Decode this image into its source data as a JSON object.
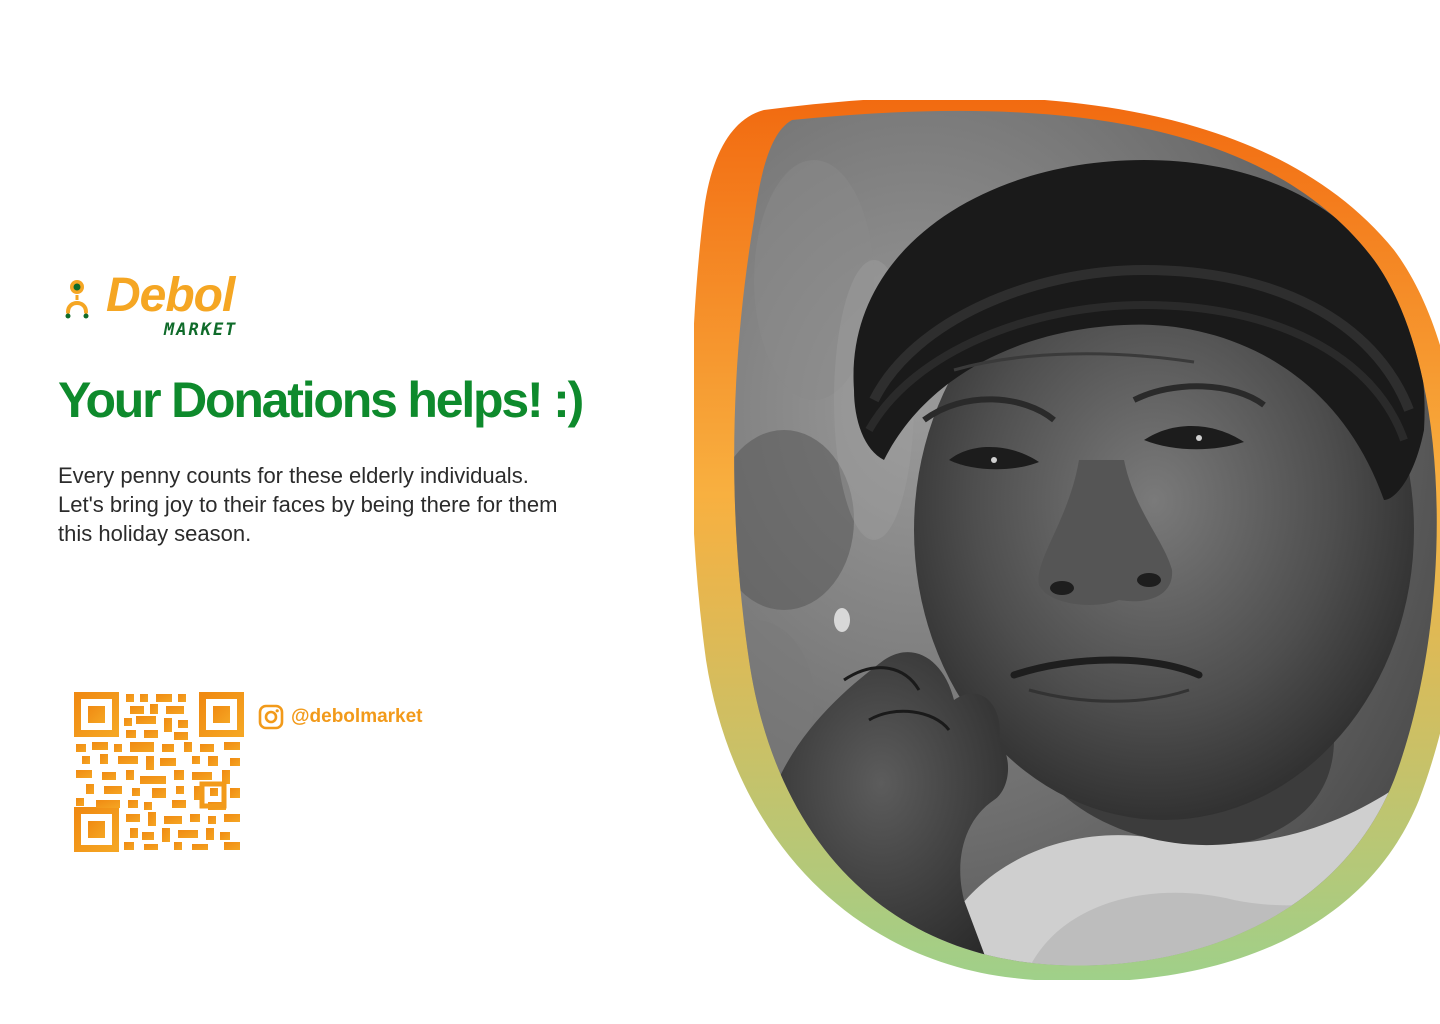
{
  "brand": {
    "name": "Debol",
    "subtitle": "MARKET",
    "primary_color": "#f5a623",
    "secondary_color": "#0f6b2a"
  },
  "headline": "Your Donations helps! :)",
  "body": "Every penny counts for these elderly individuals. Let's bring joy to their faces by being there for them this holiday season.",
  "qr_code": {
    "icon": "qr-code",
    "color": "#f39c12"
  },
  "social": {
    "platform_icon": "instagram-icon",
    "handle": "@debolmarket",
    "color": "#f29a1a"
  },
  "photo": {
    "frame_gradient": [
      "#f26a10",
      "#f8b040",
      "#9fd08a"
    ]
  }
}
